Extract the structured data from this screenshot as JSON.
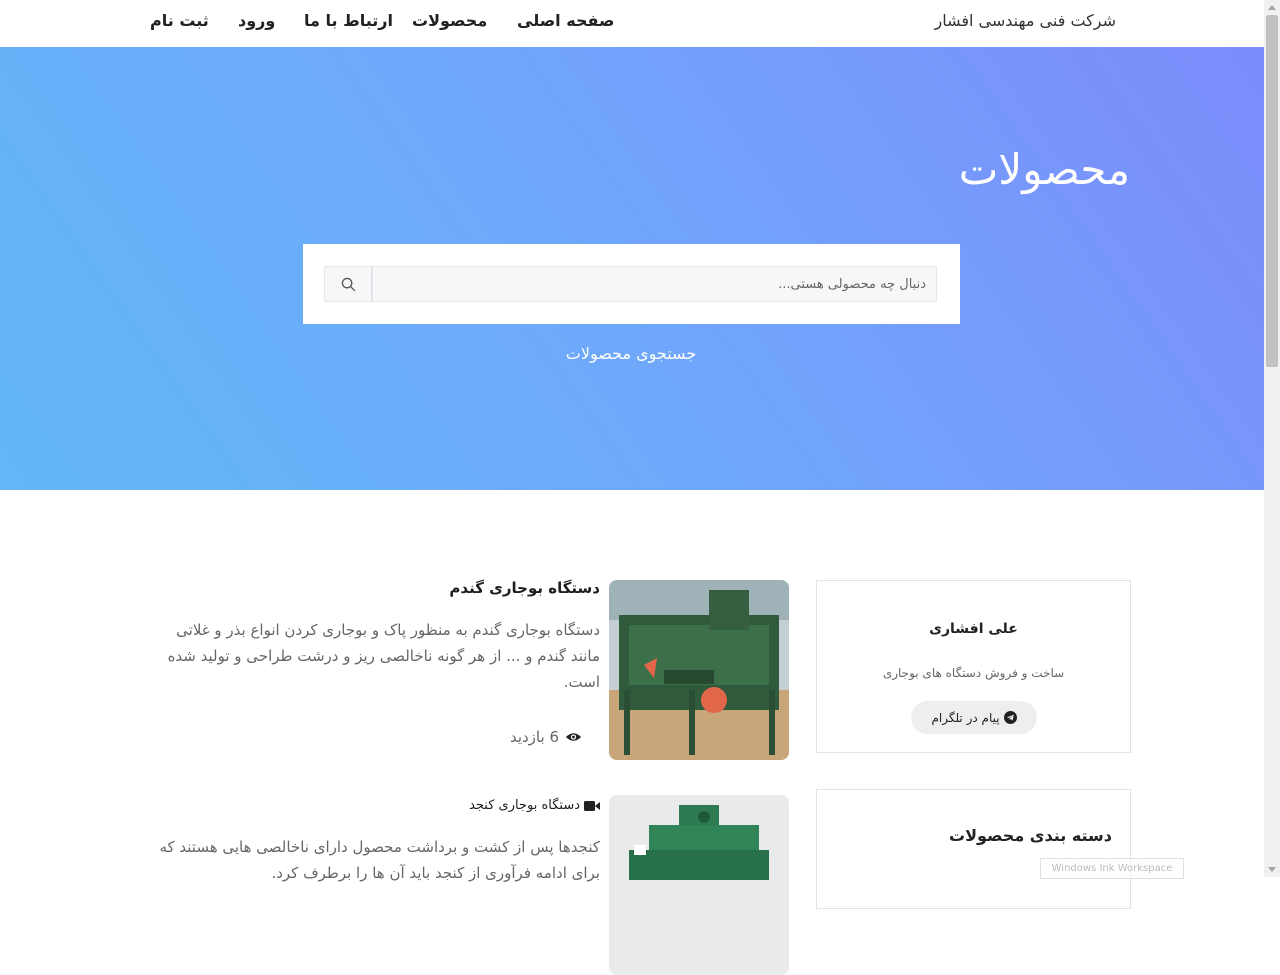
{
  "navbar": {
    "brand": "شرکت فنی مهندسی افشار",
    "links": [
      "صفحه اصلی",
      "محصولات",
      "ارتباط با ما",
      "ورود",
      "ثبت نام"
    ]
  },
  "hero": {
    "title": "محصولات",
    "search_placeholder": "دنبال چه محصولی هستی...",
    "subtitle": "جستجوی محصولات"
  },
  "agent_card": {
    "name": "علی افشاری",
    "description": "ساخت و فروش دستگاه های بوجاری",
    "telegram_button": "پیام در تلگرام"
  },
  "category_card": {
    "title": "دسته بندی محصولات"
  },
  "products": [
    {
      "title": "دستگاه بوجاری گندم",
      "description": "دستگاه بوجاری گندم به منظور پاک و بوجاری کردن انواع بذر و غلاتی مانند گندم و ... از هر گونه ناخالصی ریز و درشت طراحی و تولید شده است.",
      "views": "6 بازدید"
    },
    {
      "title": "دستگاه بوجاری کنجد",
      "description": "کنجدها پس از کشت و برداشت محصول دارای ناخالصی هایی هستند که برای ادامه فرآوری از کنجد باید آن ها را برطرف کرد."
    }
  ],
  "watermark": "Windows Ink Workspace",
  "colors": {
    "hero_gradient_start": "#62b8f8",
    "hero_gradient_end": "#7c8cfb",
    "card_border": "#e3e3e3"
  }
}
